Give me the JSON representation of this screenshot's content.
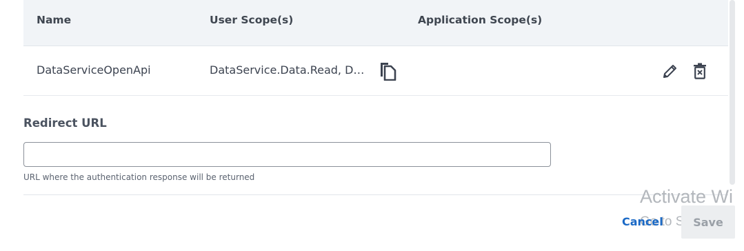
{
  "table": {
    "headers": {
      "name": "Name",
      "user_scopes": "User Scope(s)",
      "application_scopes": "Application Scope(s)"
    },
    "rows": [
      {
        "name": "DataServiceOpenApi",
        "user_scopes": "DataService.Data.Read, Dat...",
        "application_scopes": "",
        "copy_icon": "copy-icon",
        "edit_icon": "pencil-icon",
        "delete_icon": "trash-icon"
      }
    ]
  },
  "redirect_url": {
    "label": "Redirect URL",
    "value": "",
    "placeholder": "",
    "help_text": "URL where the authentication response will be returned"
  },
  "footer": {
    "cancel_label": "Cancel",
    "save_label": "Save"
  },
  "watermark": {
    "title": "Activate Wi",
    "subtitle": "Go to Settings t"
  },
  "colors": {
    "link": "#1a69c6",
    "header_bg": "#f1f4f7",
    "text": "#333b45"
  }
}
